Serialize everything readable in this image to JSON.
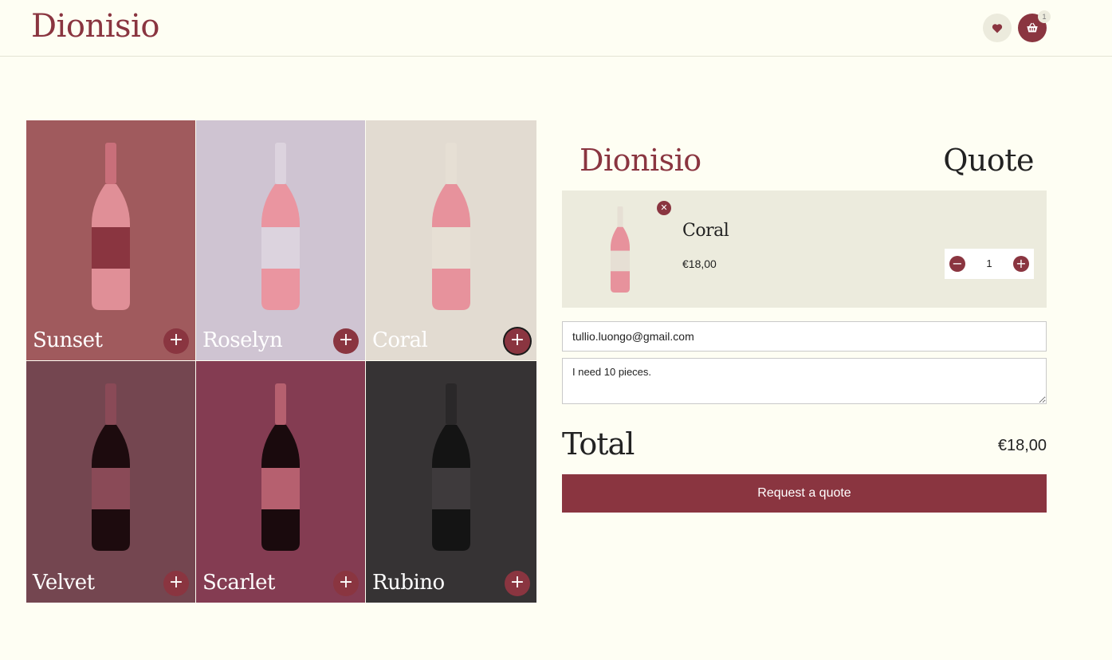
{
  "header": {
    "brand": "Dionisio",
    "cart_count": "1"
  },
  "products": [
    {
      "name": "Sunset",
      "bg": "#a05a5d",
      "wine": "#e08f97",
      "label": "#8a3540",
      "cap": "#c96f7a",
      "add": "+"
    },
    {
      "name": "Roselyn",
      "bg": "#cfc4d2",
      "wine": "#ea95a0",
      "label": "#dcd3de",
      "cap": "#dcd3de",
      "add": "+"
    },
    {
      "name": "Coral",
      "bg": "#e2dbd1",
      "wine": "#e7929c",
      "label": "#e6dfd4",
      "cap": "#e6dfd4",
      "add": "+"
    },
    {
      "name": "Velvet",
      "bg": "#744650",
      "wine": "#1d0b0e",
      "label": "#8a4a57",
      "cap": "#8a4a57",
      "add": "+"
    },
    {
      "name": "Scarlet",
      "bg": "#843c52",
      "wine": "#1a0a0d",
      "label": "#b6606f",
      "cap": "#b6606f",
      "add": "+"
    },
    {
      "name": "Rubino",
      "bg": "#363334",
      "wine": "#141414",
      "label": "#3e3a3c",
      "cap": "#2a2829",
      "add": "+"
    }
  ],
  "quote": {
    "brand": "Dionisio",
    "title": "Quote",
    "item": {
      "name": "Coral",
      "price": "€18,00",
      "quantity": "1",
      "remove": "✕",
      "minus": "−",
      "plus": "+"
    },
    "email_value": "tullio.luongo@gmail.com",
    "note_value": "I need 10 pieces.",
    "total_label": "Total",
    "total_value": "€18,00",
    "submit_label": "Request a quote"
  },
  "colors": {
    "accent": "#8a3540",
    "background": "#fefef3",
    "panel": "#ecebdd"
  }
}
